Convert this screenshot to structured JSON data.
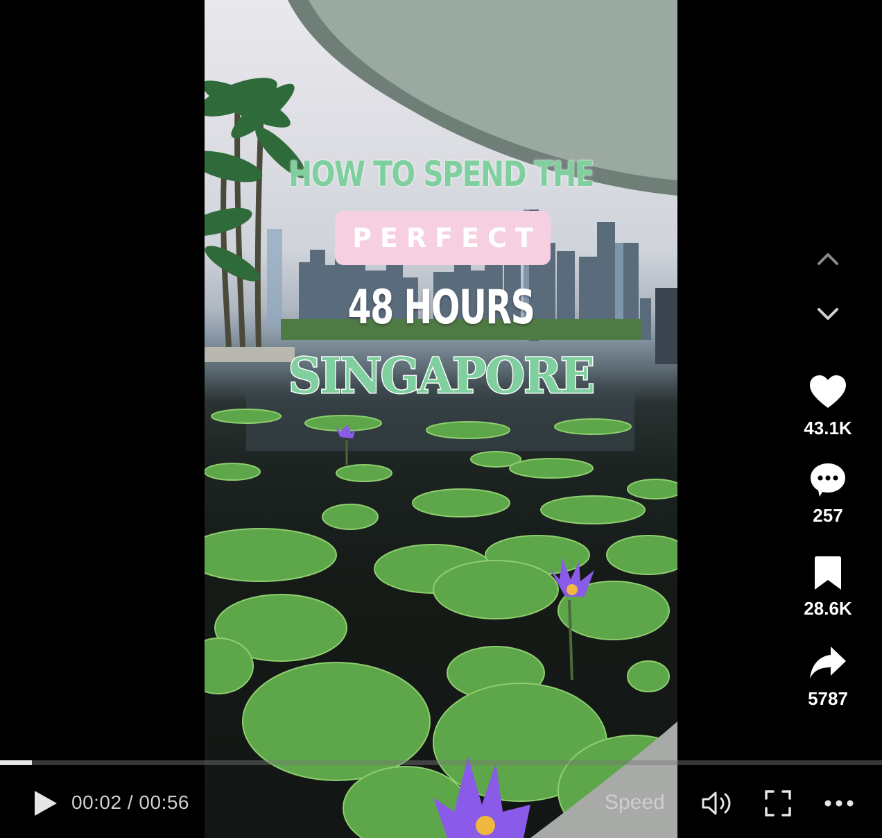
{
  "video": {
    "overlay_text": {
      "line1": "HOW TO SPEND THE",
      "line2": "PERFECT",
      "line3": "48 HOURS",
      "line4": "SINGAPORE"
    }
  },
  "player": {
    "progress_fraction": 0.036,
    "current_time": "00:02",
    "time_separator": " / ",
    "duration": "00:56",
    "speed_label": "Speed",
    "icons": [
      "play-icon",
      "volume-icon",
      "fullscreen-icon",
      "more-icon"
    ]
  },
  "rail": {
    "nav": [
      "chevron-up-icon",
      "chevron-down-icon"
    ],
    "likes": "43.1K",
    "comments": "257",
    "saves": "28.6K",
    "shares": "5787",
    "icons": [
      "heart-icon",
      "comment-icon",
      "bookmark-icon",
      "share-icon"
    ]
  },
  "colors": {
    "caption_green": "#7fcf9f",
    "caption_pink_bg": "#f6cfe0",
    "background": "#000000",
    "lotus_purple": "#8a5be8"
  }
}
